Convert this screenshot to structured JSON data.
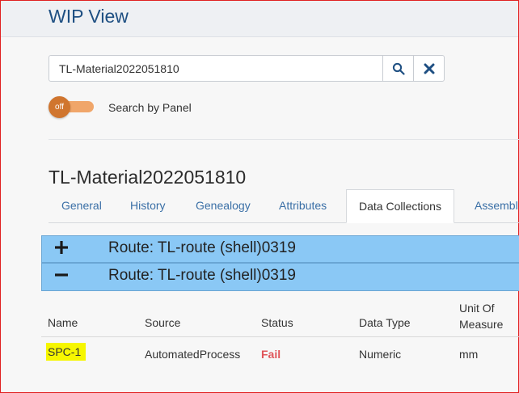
{
  "header": {
    "title": "WIP View"
  },
  "search": {
    "value": "TL-Material2022051810"
  },
  "toggle": {
    "state_label": "off",
    "label": "Search by Panel"
  },
  "item": {
    "title": "TL-Material2022051810"
  },
  "tabs": [
    {
      "label": "General"
    },
    {
      "label": "History"
    },
    {
      "label": "Genealogy"
    },
    {
      "label": "Attributes"
    },
    {
      "label": "Data Collections",
      "active": true
    },
    {
      "label": "Assembl"
    }
  ],
  "routes": [
    {
      "sign": "+",
      "label": "Route: TL-route (shell)0319"
    },
    {
      "sign": "−",
      "label": "Route: TL-route (shell)0319"
    }
  ],
  "table": {
    "columns": [
      "Name",
      "Source",
      "Status",
      "Data Type",
      "Unit Of Measure"
    ],
    "rows": [
      {
        "name": "SPC-1",
        "source": "AutomatedProcess",
        "status": "Fail",
        "data_type": "Numeric",
        "unit": "mm"
      }
    ]
  },
  "colors": {
    "accent": "#1e4f82",
    "route_bar": "#8ac8f5",
    "toggle": "#d0752e",
    "fail": "#e0555a",
    "highlight": "#f6f600"
  }
}
